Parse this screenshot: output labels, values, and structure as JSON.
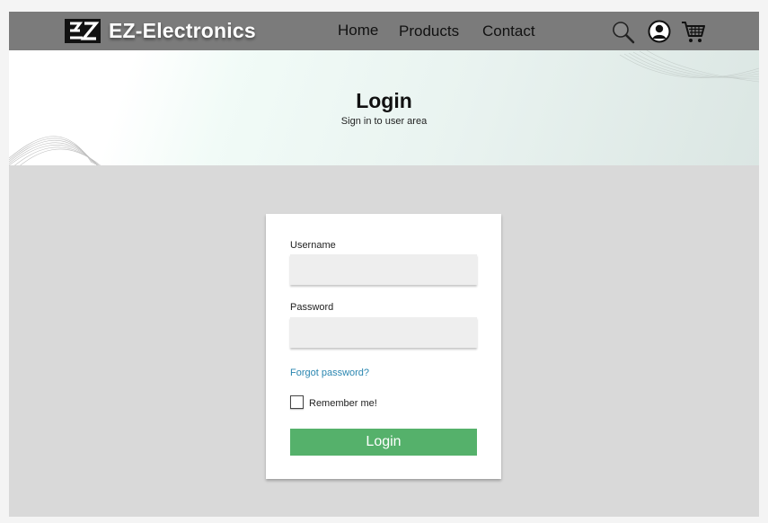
{
  "header": {
    "brand": "EZ-Electronics",
    "nav": [
      "Home",
      "Products",
      "Contact"
    ],
    "icons": [
      "search-icon",
      "account-icon",
      "cart-icon"
    ]
  },
  "hero": {
    "title": "Login",
    "subtitle": "Sign in to user area"
  },
  "login_form": {
    "username_label": "Username",
    "username_value": "",
    "password_label": "Password",
    "password_value": "",
    "forgot_link": "Forgot password?",
    "remember_label": "Remember me!",
    "remember_checked": false,
    "submit_label": "Login"
  },
  "colors": {
    "header_bg": "#7b7b7b",
    "page_bg": "#d9d9d9",
    "button_bg": "#55b16b",
    "link": "#2a86b0"
  }
}
